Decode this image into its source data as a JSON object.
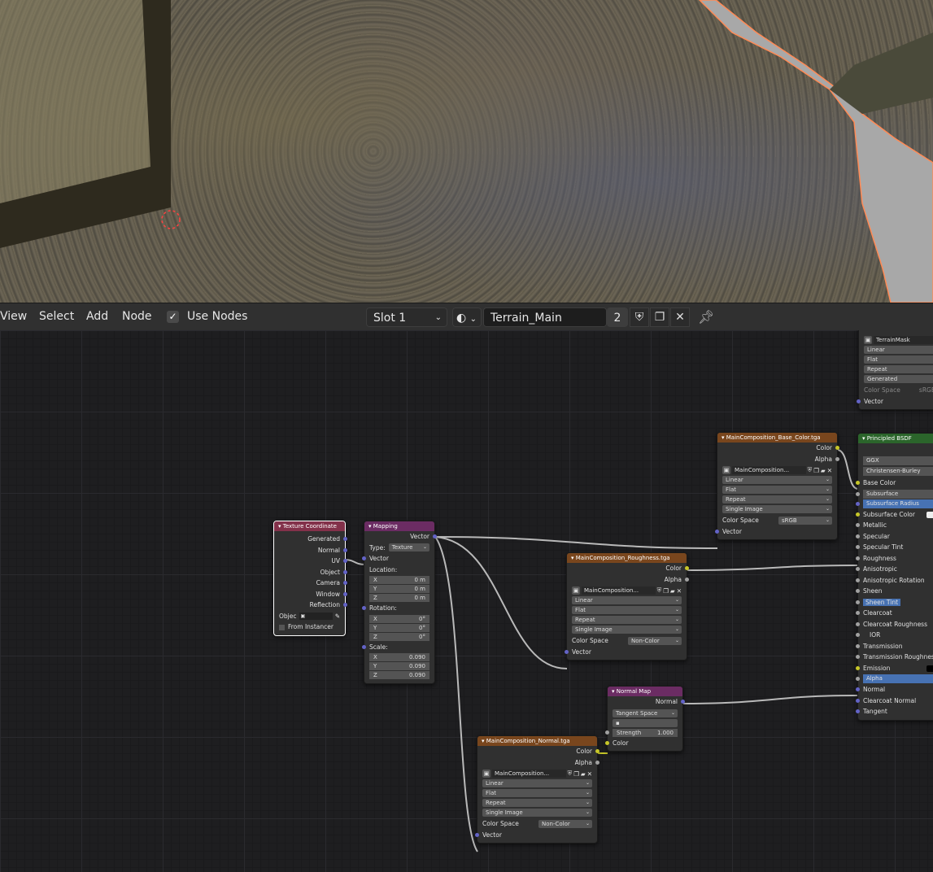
{
  "header": {
    "menus": [
      "View",
      "Select",
      "Add",
      "Node"
    ],
    "use_nodes_label": "Use Nodes",
    "use_nodes_checked": true,
    "slot": "Slot 1",
    "material_name": "Terrain_Main",
    "user_count": "2"
  },
  "icons": {
    "check": "check-icon",
    "chevron": "chevron-down-icon",
    "material": "material-sphere-icon",
    "fake_user": "shield-icon",
    "duplicate": "duplicate-icon",
    "unlink": "close-icon",
    "pin": "pin-icon"
  },
  "nodes": {
    "texcoord": {
      "title": "Texture Coordinate",
      "outputs": [
        "Generated",
        "Normal",
        "UV",
        "Object",
        "Camera",
        "Window",
        "Reflection"
      ],
      "object_label": "Objec",
      "from_instancer": "From Instancer"
    },
    "mapping": {
      "title": "Mapping",
      "output": "Vector",
      "type_label": "Type:",
      "type_value": "Texture",
      "vector_label": "Vector",
      "location_label": "Location:",
      "location": [
        {
          "k": "X",
          "v": "0 m"
        },
        {
          "k": "Y",
          "v": "0 m"
        },
        {
          "k": "Z",
          "v": "0 m"
        }
      ],
      "rotation_label": "Rotation:",
      "rotation": [
        {
          "k": "X",
          "v": "0°"
        },
        {
          "k": "Y",
          "v": "0°"
        },
        {
          "k": "Z",
          "v": "0°"
        }
      ],
      "scale_label": "Scale:",
      "scale": [
        {
          "k": "X",
          "v": "0.090"
        },
        {
          "k": "Y",
          "v": "0.090"
        },
        {
          "k": "Z",
          "v": "0.090"
        }
      ]
    },
    "basecolor": {
      "title": "MainComposition_Base_Color.tga",
      "out_color": "Color",
      "out_alpha": "Alpha",
      "image": "MainComposition...",
      "interp": "Linear",
      "proj": "Flat",
      "ext": "Repeat",
      "source": "Single Image",
      "cs_label": "Color Space",
      "cs_value": "sRGB",
      "vector": "Vector"
    },
    "roughness": {
      "title": "MainComposition_Roughness.tga",
      "out_color": "Color",
      "out_alpha": "Alpha",
      "image": "MainComposition...",
      "interp": "Linear",
      "proj": "Flat",
      "ext": "Repeat",
      "source": "Single Image",
      "cs_label": "Color Space",
      "cs_value": "Non-Color",
      "vector": "Vector"
    },
    "normal": {
      "title": "MainComposition_Normal.tga",
      "out_color": "Color",
      "out_alpha": "Alpha",
      "image": "MainComposition...",
      "interp": "Linear",
      "proj": "Flat",
      "ext": "Repeat",
      "source": "Single Image",
      "cs_label": "Color Space",
      "cs_value": "Non-Color",
      "vector": "Vector"
    },
    "normalmap": {
      "title": "Normal Map",
      "output": "Normal",
      "space": "Tangent Space",
      "strength_label": "Strength",
      "strength_value": "1.000",
      "input": "Color"
    },
    "mask": {
      "image": "TerrainMask",
      "interp": "Linear",
      "proj": "Flat",
      "ext": "Repeat",
      "source": "Generated",
      "cs_label": "Color Space",
      "cs_value": "sRGB",
      "vector": "Vector"
    },
    "bsdf": {
      "title": "Principled BSDF",
      "distribution": "GGX",
      "sss_method": "Christensen-Burley",
      "inputs": [
        "Base Color",
        "Subsurface",
        "Subsurface Radius",
        "Subsurface Color",
        "Metallic",
        "Specular",
        "Specular Tint",
        "Roughness",
        "Anisotropic",
        "Anisotropic Rotation",
        "Sheen",
        "Sheen Tint",
        "Clearcoat",
        "Clearcoat Roughness",
        "IOR",
        "Transmission",
        "Transmission Roughness",
        "Emission",
        "Alpha",
        "Normal",
        "Clearcoat Normal",
        "Tangent"
      ]
    }
  }
}
